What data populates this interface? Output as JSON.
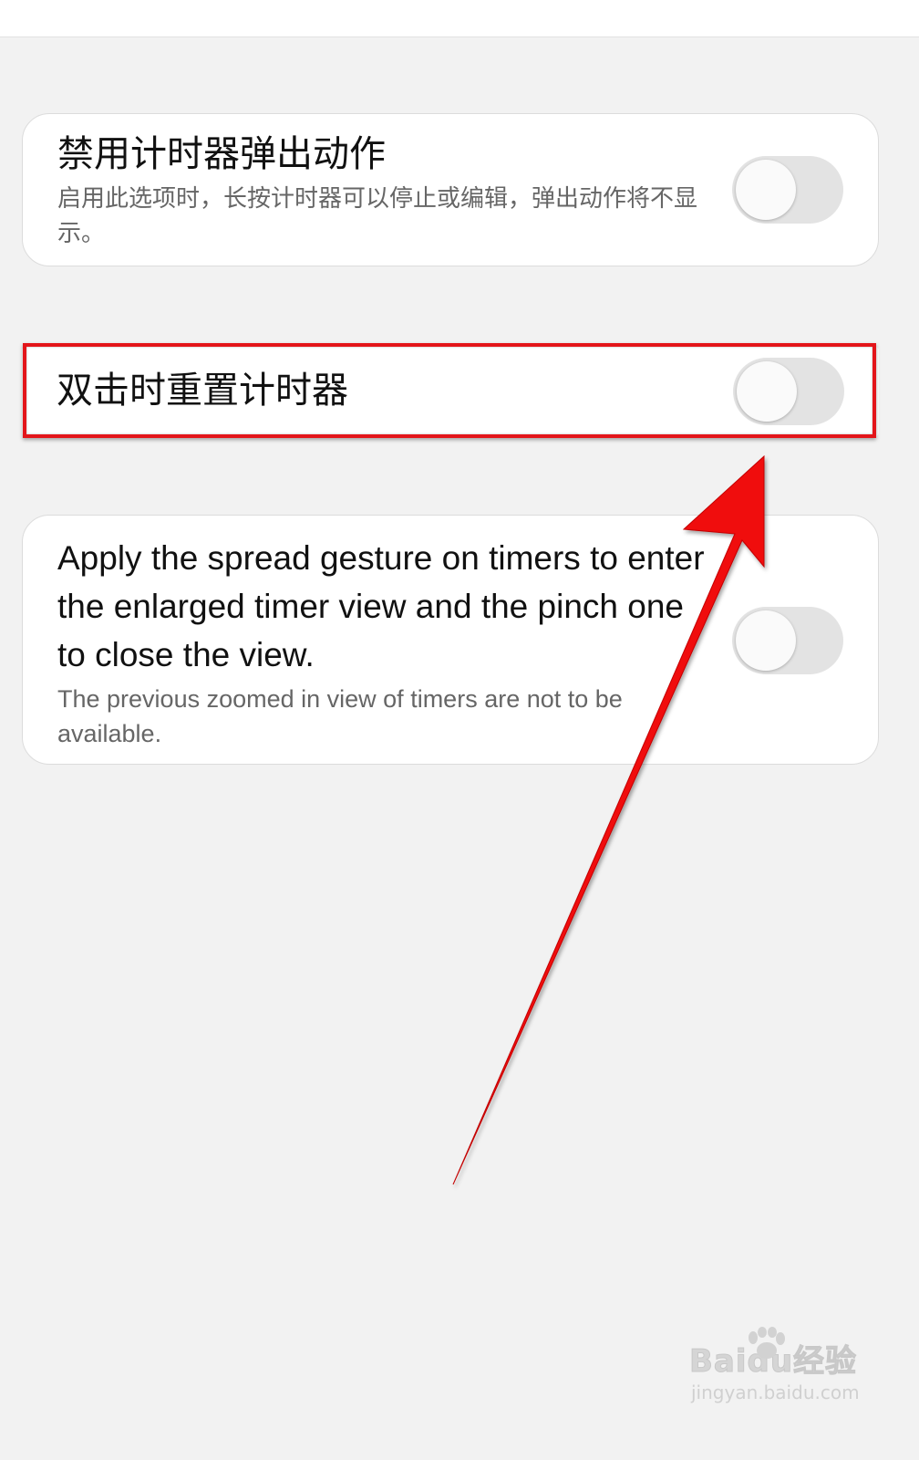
{
  "settings": [
    {
      "title": "禁用计时器弹出动作",
      "description": "启用此选项时，长按计时器可以停止或编辑，弹出动作将不显示。",
      "enabled": false
    },
    {
      "title": "双击时重置计时器",
      "enabled": false
    },
    {
      "title": "Apply the spread gesture on timers to enter the enlarged timer view and the pinch one to close the view.",
      "description": "The previous zoomed in view of timers are not to be available.",
      "enabled": false
    }
  ],
  "annotation": {
    "color": "#e3151a",
    "target": "settings.1"
  },
  "watermark": {
    "logo": "Baidu经验",
    "url": "jingyan.baidu.com"
  }
}
